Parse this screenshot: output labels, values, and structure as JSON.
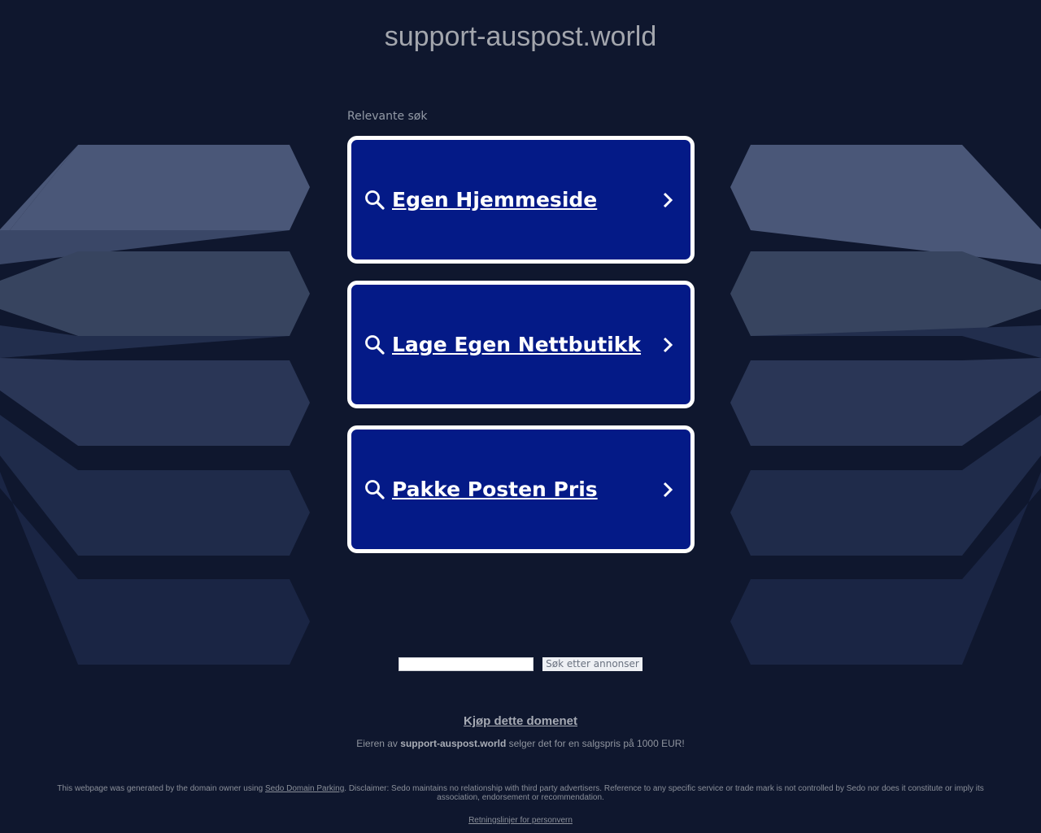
{
  "header": {
    "domain": "support-auspost.world"
  },
  "related": {
    "label": "Relevante søk",
    "items": [
      {
        "label": "Egen Hjemmeside"
      },
      {
        "label": "Lage Egen Nettbutikk"
      },
      {
        "label": "Pakke Posten Pris"
      }
    ]
  },
  "search": {
    "input_value": "",
    "button_label": "Søk etter annonser"
  },
  "sale": {
    "link_label": "Kjøp dette domenet",
    "owner_prefix": "Eieren av",
    "owner_domain": "support-auspost.world",
    "owner_suffix": "selger det for en salgspris på 1000 EUR!"
  },
  "footer": {
    "generated_prefix": "This webpage was generated by the domain owner using",
    "sedo_link": "Sedo Domain Parking",
    "disclaimer": ". Disclaimer: Sedo maintains no relationship with third party advertisers. Reference to any specific service or trade mark is not controlled by Sedo nor does it constitute or imply its association, endorsement or recommendation.",
    "privacy_link": "Retningslinjer for personvern"
  },
  "colors": {
    "background": "#0f172e",
    "card": "#041a87",
    "card_border": "#ffffff"
  }
}
